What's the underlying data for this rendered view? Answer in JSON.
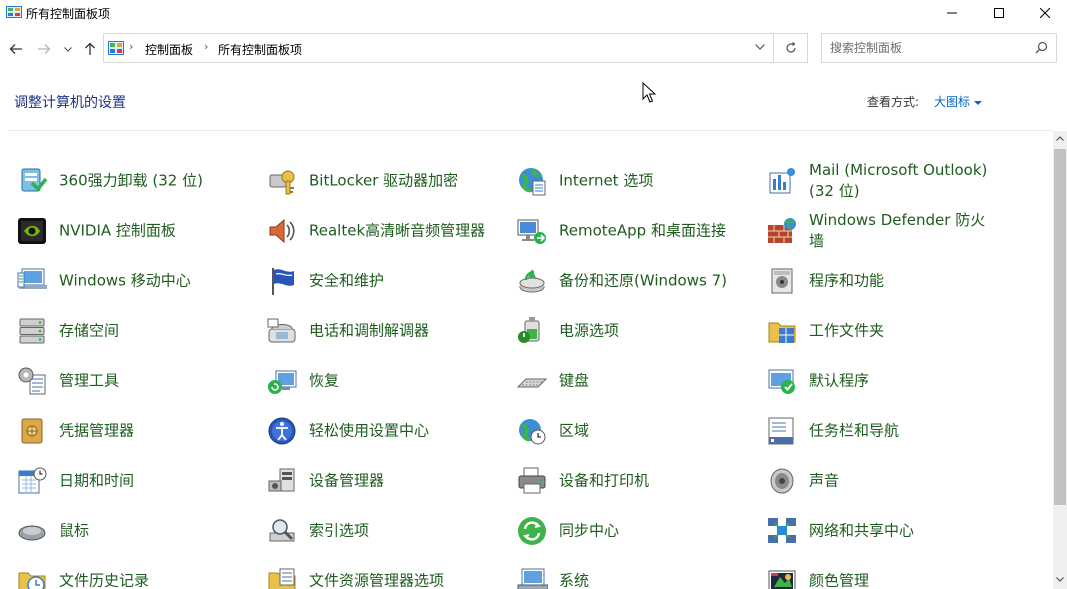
{
  "window": {
    "title": "所有控制面板项"
  },
  "address": {
    "crumbs": [
      "控制面板",
      "所有控制面板项"
    ]
  },
  "search": {
    "placeholder": "搜索控制面板"
  },
  "header": {
    "heading": "调整计算机的设置",
    "view_by_label": "查看方式:",
    "view_by_value": "大图标"
  },
  "items": [
    {
      "label": "360强力卸载 (32 位)",
      "icon": "uninstall-icon"
    },
    {
      "label": "BitLocker 驱动器加密",
      "icon": "bitlocker-key-icon"
    },
    {
      "label": "Internet 选项",
      "icon": "globe-icon"
    },
    {
      "label": "Mail (Microsoft Outlook) (32 位)",
      "icon": "mail-icon"
    },
    {
      "label": "NVIDIA 控制面板",
      "icon": "nvidia-icon"
    },
    {
      "label": "Realtek高清晰音频管理器",
      "icon": "speaker-icon"
    },
    {
      "label": "RemoteApp 和桌面连接",
      "icon": "remote-desktop-icon"
    },
    {
      "label": "Windows Defender 防火墙",
      "icon": "firewall-icon"
    },
    {
      "label": "Windows 移动中心",
      "icon": "mobility-center-icon"
    },
    {
      "label": "安全和维护",
      "icon": "flag-icon"
    },
    {
      "label": "备份和还原(Windows 7)",
      "icon": "backup-icon"
    },
    {
      "label": "程序和功能",
      "icon": "programs-icon"
    },
    {
      "label": "存储空间",
      "icon": "storage-icon"
    },
    {
      "label": "电话和调制解调器",
      "icon": "phone-icon"
    },
    {
      "label": "电源选项",
      "icon": "power-icon"
    },
    {
      "label": "工作文件夹",
      "icon": "folder-icon"
    },
    {
      "label": "管理工具",
      "icon": "admin-tools-icon"
    },
    {
      "label": "恢复",
      "icon": "recovery-icon"
    },
    {
      "label": "键盘",
      "icon": "keyboard-icon"
    },
    {
      "label": "默认程序",
      "icon": "default-programs-icon"
    },
    {
      "label": "凭据管理器",
      "icon": "credential-vault-icon"
    },
    {
      "label": "轻松使用设置中心",
      "icon": "ease-of-access-icon"
    },
    {
      "label": "区域",
      "icon": "region-icon"
    },
    {
      "label": "任务栏和导航",
      "icon": "taskbar-icon"
    },
    {
      "label": "日期和时间",
      "icon": "calendar-clock-icon"
    },
    {
      "label": "设备管理器",
      "icon": "device-manager-icon"
    },
    {
      "label": "设备和打印机",
      "icon": "printer-icon"
    },
    {
      "label": "声音",
      "icon": "sound-icon"
    },
    {
      "label": "鼠标",
      "icon": "mouse-icon"
    },
    {
      "label": "索引选项",
      "icon": "indexing-icon"
    },
    {
      "label": "同步中心",
      "icon": "sync-icon"
    },
    {
      "label": "网络和共享中心",
      "icon": "network-icon"
    },
    {
      "label": "文件历史记录",
      "icon": "file-history-icon"
    },
    {
      "label": "文件资源管理器选项",
      "icon": "explorer-options-icon"
    },
    {
      "label": "系统",
      "icon": "system-icon"
    },
    {
      "label": "颜色管理",
      "icon": "color-management-icon"
    }
  ]
}
